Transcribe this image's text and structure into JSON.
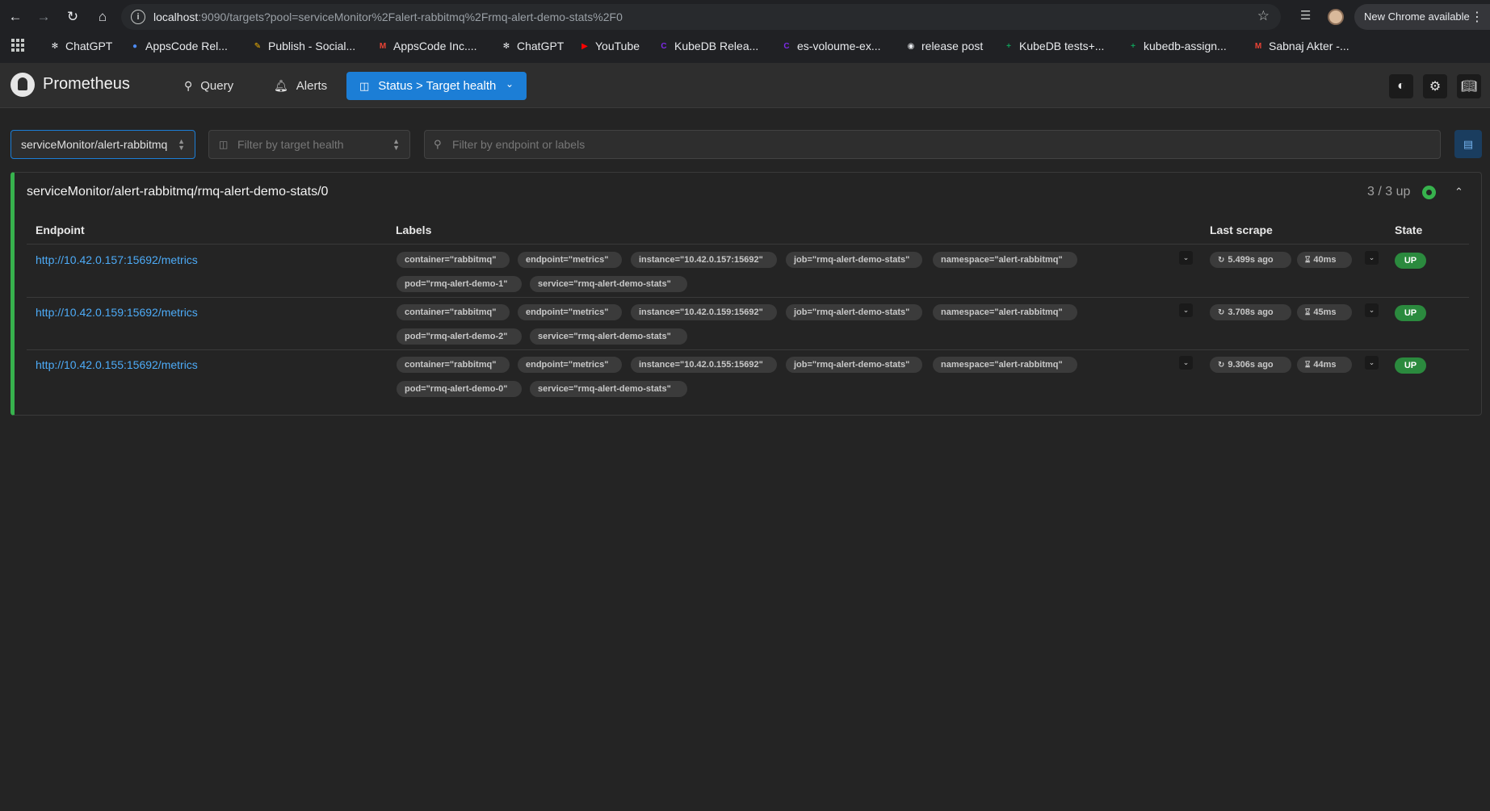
{
  "browser": {
    "url_host": "localhost",
    "url_rest": ":9090/targets?pool=serviceMonitor%2Falert-rabbitmq%2Frmq-alert-demo-stats%2F0",
    "update_label": "New Chrome available",
    "bookmarks": [
      {
        "label": "ChatGPT",
        "icon": "chatgpt-icon",
        "color": "#e8eaed"
      },
      {
        "label": "AppsCode Rel...",
        "icon": "people-icon",
        "color": "#4c8bf5"
      },
      {
        "label": "Publish - Social...",
        "icon": "edit-icon",
        "color": "#f4b400"
      },
      {
        "label": "AppsCode Inc....",
        "icon": "gmail-icon",
        "color": "#ea4335"
      },
      {
        "label": "ChatGPT",
        "icon": "chatgpt-icon",
        "color": "#e8eaed"
      },
      {
        "label": "YouTube",
        "icon": "youtube-icon",
        "color": "#ff0000"
      },
      {
        "label": "KubeDB Relea...",
        "icon": "canva-icon",
        "color": "#7d2ae8"
      },
      {
        "label": "es-voloume-ex...",
        "icon": "canva-icon",
        "color": "#7d2ae8"
      },
      {
        "label": "release post",
        "icon": "github-icon",
        "color": "#e8eaed"
      },
      {
        "label": "KubeDB tests+...",
        "icon": "sheets-icon",
        "color": "#0f9d58"
      },
      {
        "label": "kubedb-assign...",
        "icon": "sheets-icon",
        "color": "#0f9d58"
      },
      {
        "label": "Sabnaj Akter -...",
        "icon": "gmail-icon",
        "color": "#ea4335"
      }
    ]
  },
  "header": {
    "title": "Prometheus",
    "nav_query": "Query",
    "nav_alerts": "Alerts",
    "nav_status": "Status > Target health"
  },
  "filters": {
    "pool_value": "serviceMonitor/alert-rabbitmq",
    "health_placeholder": "Filter by target health",
    "search_placeholder": "Filter by endpoint or labels"
  },
  "pool": {
    "name": "serviceMonitor/alert-rabbitmq/rmq-alert-demo-stats/0",
    "count": "3 / 3 up",
    "status_color": "#37b24d",
    "columns": {
      "endpoint": "Endpoint",
      "labels": "Labels",
      "last_scrape": "Last scrape",
      "state": "State"
    },
    "targets": [
      {
        "endpoint": "http://10.42.0.157:15692/metrics",
        "labels": [
          "container=\"rabbitmq\"",
          "endpoint=\"metrics\"",
          "instance=\"10.42.0.157:15692\"",
          "job=\"rmq-alert-demo-stats\"",
          "namespace=\"alert-rabbitmq\"",
          "pod=\"rmq-alert-demo-1\"",
          "service=\"rmq-alert-demo-stats\""
        ],
        "last_scrape": "5.499s ago",
        "duration": "40ms",
        "state": "UP"
      },
      {
        "endpoint": "http://10.42.0.159:15692/metrics",
        "labels": [
          "container=\"rabbitmq\"",
          "endpoint=\"metrics\"",
          "instance=\"10.42.0.159:15692\"",
          "job=\"rmq-alert-demo-stats\"",
          "namespace=\"alert-rabbitmq\"",
          "pod=\"rmq-alert-demo-2\"",
          "service=\"rmq-alert-demo-stats\""
        ],
        "last_scrape": "3.708s ago",
        "duration": "45ms",
        "state": "UP"
      },
      {
        "endpoint": "http://10.42.0.155:15692/metrics",
        "labels": [
          "container=\"rabbitmq\"",
          "endpoint=\"metrics\"",
          "instance=\"10.42.0.155:15692\"",
          "job=\"rmq-alert-demo-stats\"",
          "namespace=\"alert-rabbitmq\"",
          "pod=\"rmq-alert-demo-0\"",
          "service=\"rmq-alert-demo-stats\""
        ],
        "last_scrape": "9.306s ago",
        "duration": "44ms",
        "state": "UP"
      }
    ]
  }
}
